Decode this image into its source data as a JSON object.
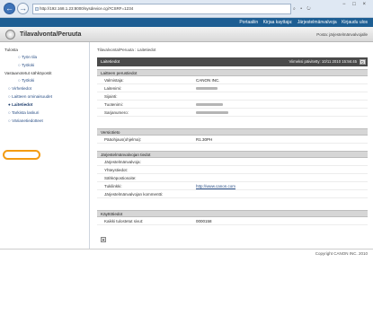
{
  "browser": {
    "url": "http://192.168.1.23:8000/sysdevice.cgi?CSRF=1234",
    "tools": "⌕ • ↻",
    "win_controls": [
      "−",
      "□",
      "×"
    ]
  },
  "top_links": [
    "Portaaliin",
    "Kirjaa kayttaja:",
    "Järjestelmänvalvoja",
    "Kirjaudu ulos"
  ],
  "title": {
    "text": "Tilavalvonta/Peruuta",
    "right_link": "Posta: järjestelmänvalvojalle"
  },
  "sidebar": {
    "groups": [
      {
        "label": "Tulosta",
        "items": [
          {
            "label": "Työn tila",
            "sub": true
          },
          {
            "label": "Työloki",
            "sub": true
          }
        ]
      },
      {
        "label": "Vastaanotetut sähköpostit",
        "items": [
          {
            "label": "Työloki",
            "sub": true
          },
          {
            "label": "Virhetiedot",
            "sub": false
          },
          {
            "label": "Laitteen ominaisuudet",
            "sub": false
          },
          {
            "label": "Laitetiedot",
            "sub": false,
            "active": true
          },
          {
            "label": "Tarkista laskuri",
            "sub": false
          },
          {
            "label": "Värianetiedotteet",
            "sub": false
          }
        ]
      }
    ]
  },
  "content": {
    "breadcrumb": "Tilavalvonta/Peruuta : Laitetiedot",
    "heading": "Laitetiedot",
    "updated": "Viimeksi päivitetty: 10/11 2010 15:56:45",
    "refresh_icon": "↻",
    "sections": [
      {
        "title": "Laitteen perustiedot",
        "rows": [
          {
            "label": "Valmistaja:",
            "value": "CANON INC."
          },
          {
            "label": "Laitenimi:",
            "value": "",
            "blur_width_pct": 8
          },
          {
            "label": "Sijainti:",
            "value": ""
          },
          {
            "label": "Tuotenimi:",
            "value": "",
            "blur_width_pct": 10
          },
          {
            "label": "Sarjanumero:",
            "value": "",
            "blur_width_pct": 12
          }
        ]
      },
      {
        "title": "Versiotieto",
        "rows": [
          {
            "label": "Pääohjaus(ohjelma):",
            "value": "R1.30PH"
          }
        ]
      },
      {
        "title": "Järjestelmänvalvojan tiedot",
        "rows": [
          {
            "label": "Järjestelmänvalvoja:",
            "value": ""
          },
          {
            "label": "Yhteystiedot:",
            "value": ""
          },
          {
            "label": "Sähköpostiosoite:",
            "value": ""
          },
          {
            "label": "Tukilinkki:",
            "value": "http://www.canon.com",
            "link": true
          },
          {
            "label": "Järjestelmänvalvojan kommentti:",
            "value": ""
          }
        ]
      },
      {
        "title": "Käyttötiedot",
        "rows": [
          {
            "label": "Kaikki tulostetut sivut:",
            "value": "0000158"
          }
        ]
      }
    ],
    "bottom_icon": "▴"
  },
  "footer": {
    "copyright": "Copyright CANON INC. 2010"
  }
}
